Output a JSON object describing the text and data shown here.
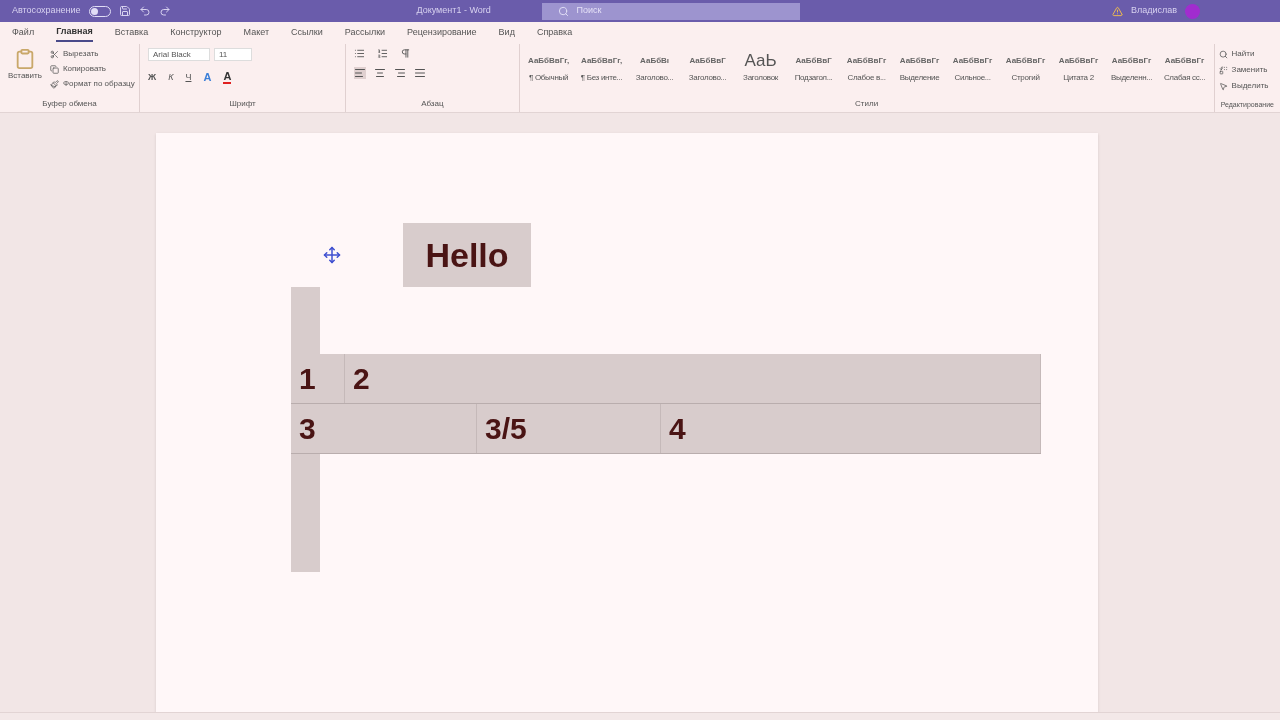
{
  "title_bar": {
    "autosave_label": "Автосохранение",
    "autosave_on": false,
    "title": "Документ1 - Word",
    "search_placeholder": "Поиск",
    "user": "Владислав"
  },
  "tabs": [
    {
      "label": "Файл",
      "selected": false
    },
    {
      "label": "Главная",
      "selected": true
    },
    {
      "label": "Вставка",
      "selected": false
    },
    {
      "label": "Конструктор",
      "selected": false
    },
    {
      "label": "Макет",
      "selected": false
    },
    {
      "label": "Ссылки",
      "selected": false
    },
    {
      "label": "Рассылки",
      "selected": false
    },
    {
      "label": "Рецензирование",
      "selected": false
    },
    {
      "label": "Вид",
      "selected": false
    },
    {
      "label": "Справка",
      "selected": false
    }
  ],
  "clipboard": {
    "paste": "Вставить",
    "items": [
      "Вырезать",
      "Копировать",
      "Формат по образцу"
    ],
    "label": "Буфер обмена"
  },
  "font": {
    "family": "Arial Black",
    "size": "11",
    "label": "Шрифт",
    "format_buttons": [
      {
        "kind": "bold",
        "label": "Ж"
      },
      {
        "kind": "italic",
        "label": "К"
      },
      {
        "kind": "underline",
        "label": "Ч"
      },
      {
        "kind": "effects",
        "label": "A"
      },
      {
        "kind": "color",
        "label": "A"
      }
    ]
  },
  "paragraph": {
    "label": "Абзац"
  },
  "styles": {
    "label": "Стили",
    "items": [
      {
        "sample": "АаБбВвГг,",
        "name": "¶ Обычный"
      },
      {
        "sample": "АаБбВвГг,",
        "name": "¶ Без инте..."
      },
      {
        "sample": "АаБбВı",
        "name": "Заголово..."
      },
      {
        "sample": "АаБбВвГ",
        "name": "Заголово..."
      },
      {
        "sample": "АаЬ",
        "name": "Заголовок",
        "large": true
      },
      {
        "sample": "АаБбВвГ",
        "name": "Подзагол..."
      },
      {
        "sample": "АаБбВвГг",
        "name": "Слабое в..."
      },
      {
        "sample": "АаБбВвГг",
        "name": "Выделение"
      },
      {
        "sample": "АаБбВвГг",
        "name": "Сильное..."
      },
      {
        "sample": "АаБбВвГг",
        "name": "Строгий"
      },
      {
        "sample": "АаБбВвГг",
        "name": "Цитата 2"
      },
      {
        "sample": "АаБбВвГг",
        "name": "Выделенн..."
      },
      {
        "sample": "АаБбВвГг",
        "name": "Слабая сс..."
      }
    ]
  },
  "editing": {
    "label": "Редактирование",
    "items": [
      "Найти",
      "Заменить",
      "Выделить"
    ]
  },
  "document": {
    "heading": "Hello",
    "table": [
      [
        "1",
        "2"
      ],
      [
        "3",
        "3/5",
        "4"
      ]
    ]
  }
}
